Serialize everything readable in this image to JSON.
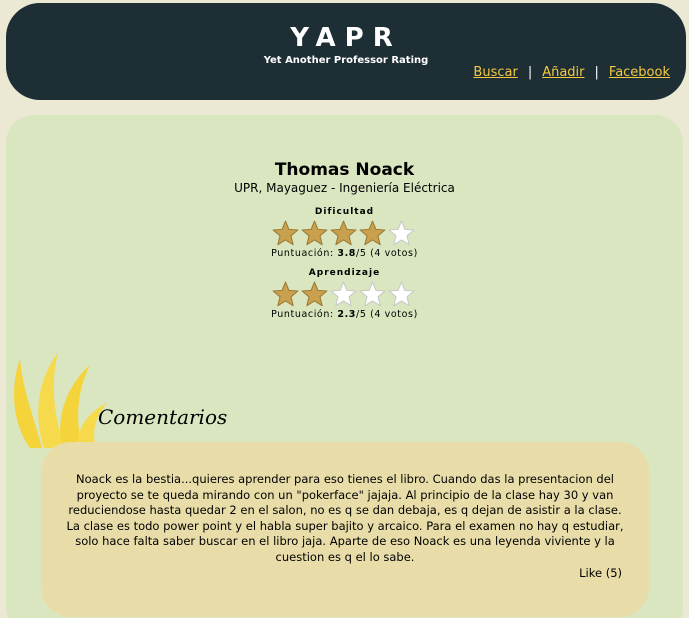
{
  "site": {
    "title": "YAPR",
    "subtitle": "Yet Another Professor Rating"
  },
  "nav": {
    "items": [
      "Buscar",
      "Añadir",
      "Facebook"
    ],
    "separator": "|"
  },
  "professor": {
    "name": "Thomas Noack",
    "department": "UPR, Mayaguez - Ingeniería Eléctrica"
  },
  "ratings": [
    {
      "label": "Dificultad",
      "score_prefix": "Puntuación: ",
      "score": "3.8",
      "score_suffix": "/5 (4 votos)",
      "value": 3.8,
      "max": 5,
      "filled_stars": 4
    },
    {
      "label": "Aprendizaje",
      "score_prefix": "Puntuación: ",
      "score": "2.3",
      "score_suffix": "/5 (4 votos)",
      "value": 2.3,
      "max": 5,
      "filled_stars": 2
    }
  ],
  "comments": {
    "heading": "Comentarios",
    "items": [
      {
        "text": "Noack es la bestia...quieres aprender para eso tienes el libro. Cuando das la presentacion del proyecto se te queda mirando con un \"pokerface\" jajaja. Al principio de la clase hay 30 y van reduciendose hasta quedar 2 en el salon, no es q se dan debaja, es q dejan de asistir a la clase. La clase es todo power point y el habla super bajito y arcaico. Para el examen no hay q estudiar, solo hace falta saber buscar en el libro jaja. Aparte de eso Noack es una leyenda viviente y la cuestion es q el lo sabe.",
        "like_label": "Like (5)"
      }
    ]
  },
  "colors": {
    "header_bg": "#1d2e35",
    "link": "#f5c842",
    "main_bg": "#d9e6c0",
    "comment_bg": "#e8dda8",
    "star_gold": "#c9a14e",
    "flame": "#f5d33a"
  },
  "icons": {
    "star_filled": "gold-star-icon",
    "star_empty": "empty-star-icon",
    "decoration": "flame-leaf-icon"
  }
}
